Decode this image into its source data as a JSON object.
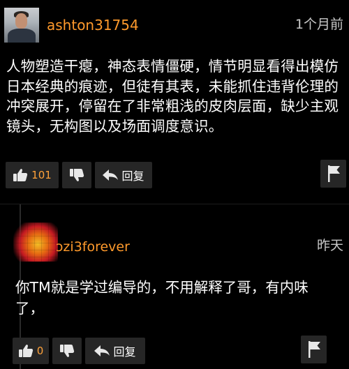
{
  "comment": {
    "username": "ashton31754",
    "time": "1个月前",
    "text": "人物塑造干瘪，神态表情僵硬，情节明显看得出模仿日本经典的痕迹，但徒有其表，未能抓住违背伦理的冲突展开，停留在了非常粗浅的皮肉层面，缺少主观镜头，无构图以及场面调度意识。",
    "likes": "101",
    "reply_label": "回复"
  },
  "reply": {
    "username": "ɔzi3forever",
    "time": "昨天",
    "text": "你TM就是学过编导的，不用解释了哥，有内味了，",
    "likes": "0",
    "reply_label": "回复"
  },
  "icons": {
    "like": "thumbs-up-icon",
    "dislike": "thumbs-down-icon",
    "reply": "reply-arrow-icon",
    "flag": "flag-icon"
  },
  "colors": {
    "username": "#ff9a2c",
    "count": "#ffa23a",
    "background": "#000000",
    "button": "#262626"
  }
}
